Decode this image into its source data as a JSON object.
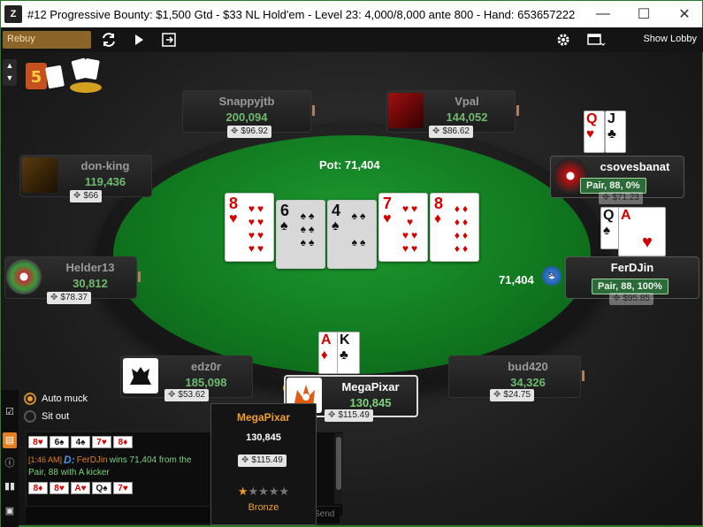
{
  "window": {
    "app_icon": "Z",
    "title": "#12 Progressive Bounty: $1,500 Gtd - $33 NL Hold'em - Level 23: 4,000/8,000 ante 800 - Hand: 653657222",
    "minimize": "—",
    "maximize": "☐",
    "close": "✕"
  },
  "toolbar": {
    "rebuy_label": "Rebuy",
    "show_lobby": "Show Lobby"
  },
  "table": {
    "pot_label": "Pot: 71,404",
    "board": [
      {
        "rank": "8",
        "suit": "♥",
        "color": "#d40000"
      },
      {
        "rank": "6",
        "suit": "♠",
        "color": "#111111"
      },
      {
        "rank": "4",
        "suit": "♠",
        "color": "#111111"
      },
      {
        "rank": "7",
        "suit": "♥",
        "color": "#d40000"
      },
      {
        "rank": "8",
        "suit": "♦",
        "color": "#d40000"
      }
    ],
    "bet_amount": "71,404",
    "bet_chip": "5k",
    "dealer_button": "D"
  },
  "players": {
    "snappyjtb": {
      "name": "Snappyjtb",
      "stack": "200,094",
      "bounty": "$96.92"
    },
    "vpal": {
      "name": "Vpal",
      "stack": "144,052",
      "bounty": "$86.62"
    },
    "donking": {
      "name": "don-king",
      "stack": "119,436",
      "bounty": "$66"
    },
    "csovesbanat": {
      "name": "csovesbanat",
      "hand": "Pair, 88, 0%",
      "bounty": "$71.23",
      "cards": [
        {
          "rank": "Q",
          "suit": "♥"
        },
        {
          "rank": "J",
          "suit": "♣"
        }
      ]
    },
    "helder13": {
      "name": "Helder13",
      "stack": "30,812",
      "bounty": "$78.37"
    },
    "ferdjin": {
      "name": "FerDJin",
      "hand": "Pair, 88, 100%",
      "bounty": "$95.85",
      "cards": [
        {
          "rank": "Q",
          "suit": "♠"
        },
        {
          "rank": "A",
          "suit": "♥"
        }
      ]
    },
    "edz0r": {
      "name": "edz0r",
      "stack": "185,098",
      "bounty": "$53.62"
    },
    "bud420": {
      "name": "bud420",
      "stack": "34,326",
      "bounty": "$24.75"
    },
    "megapixar": {
      "name": "MegaPixar",
      "stack": "130,845",
      "bounty": "$115.49",
      "cards": [
        {
          "rank": "A",
          "suit": "♦"
        },
        {
          "rank": "K",
          "suit": "♣"
        }
      ]
    }
  },
  "options": {
    "auto_muck": "Auto muck",
    "sit_out": "Sit out",
    "auto_muck_checked": true
  },
  "chat": {
    "row1_cards": [
      {
        "r": "8",
        "s": "♥",
        "c": "#d40000"
      },
      {
        "r": "6",
        "s": "♠",
        "c": "#111111"
      },
      {
        "r": "4",
        "s": "♠",
        "c": "#111111"
      },
      {
        "r": "7",
        "s": "♥",
        "c": "#d40000"
      },
      {
        "r": "8",
        "s": "♦",
        "c": "#d40000"
      }
    ],
    "time": "[1:46 AM]",
    "dealer_tag": "D:",
    "msg_player": "FerDJin",
    "msg_text": "wins 71,404 from the",
    "msg_line2": "Pair, 88 with A kicker",
    "row3_cards": [
      {
        "r": "8",
        "s": "♦",
        "c": "#d40000"
      },
      {
        "r": "8",
        "s": "♥",
        "c": "#d40000"
      },
      {
        "r": "A",
        "s": "♥",
        "c": "#d40000"
      },
      {
        "r": "Q",
        "s": "♠",
        "c": "#111111"
      },
      {
        "r": "7",
        "s": "♥",
        "c": "#d40000"
      }
    ],
    "send": "Send"
  },
  "popup": {
    "name": "MegaPixar",
    "stack": "130,845",
    "bounty": "$115.49",
    "stars_filled": 1,
    "stars_total": 5,
    "rank": "Bronze"
  },
  "colors": {
    "felt": "#117a20",
    "accent_orange": "#f0a030",
    "stack_green": "#6fba6f"
  }
}
